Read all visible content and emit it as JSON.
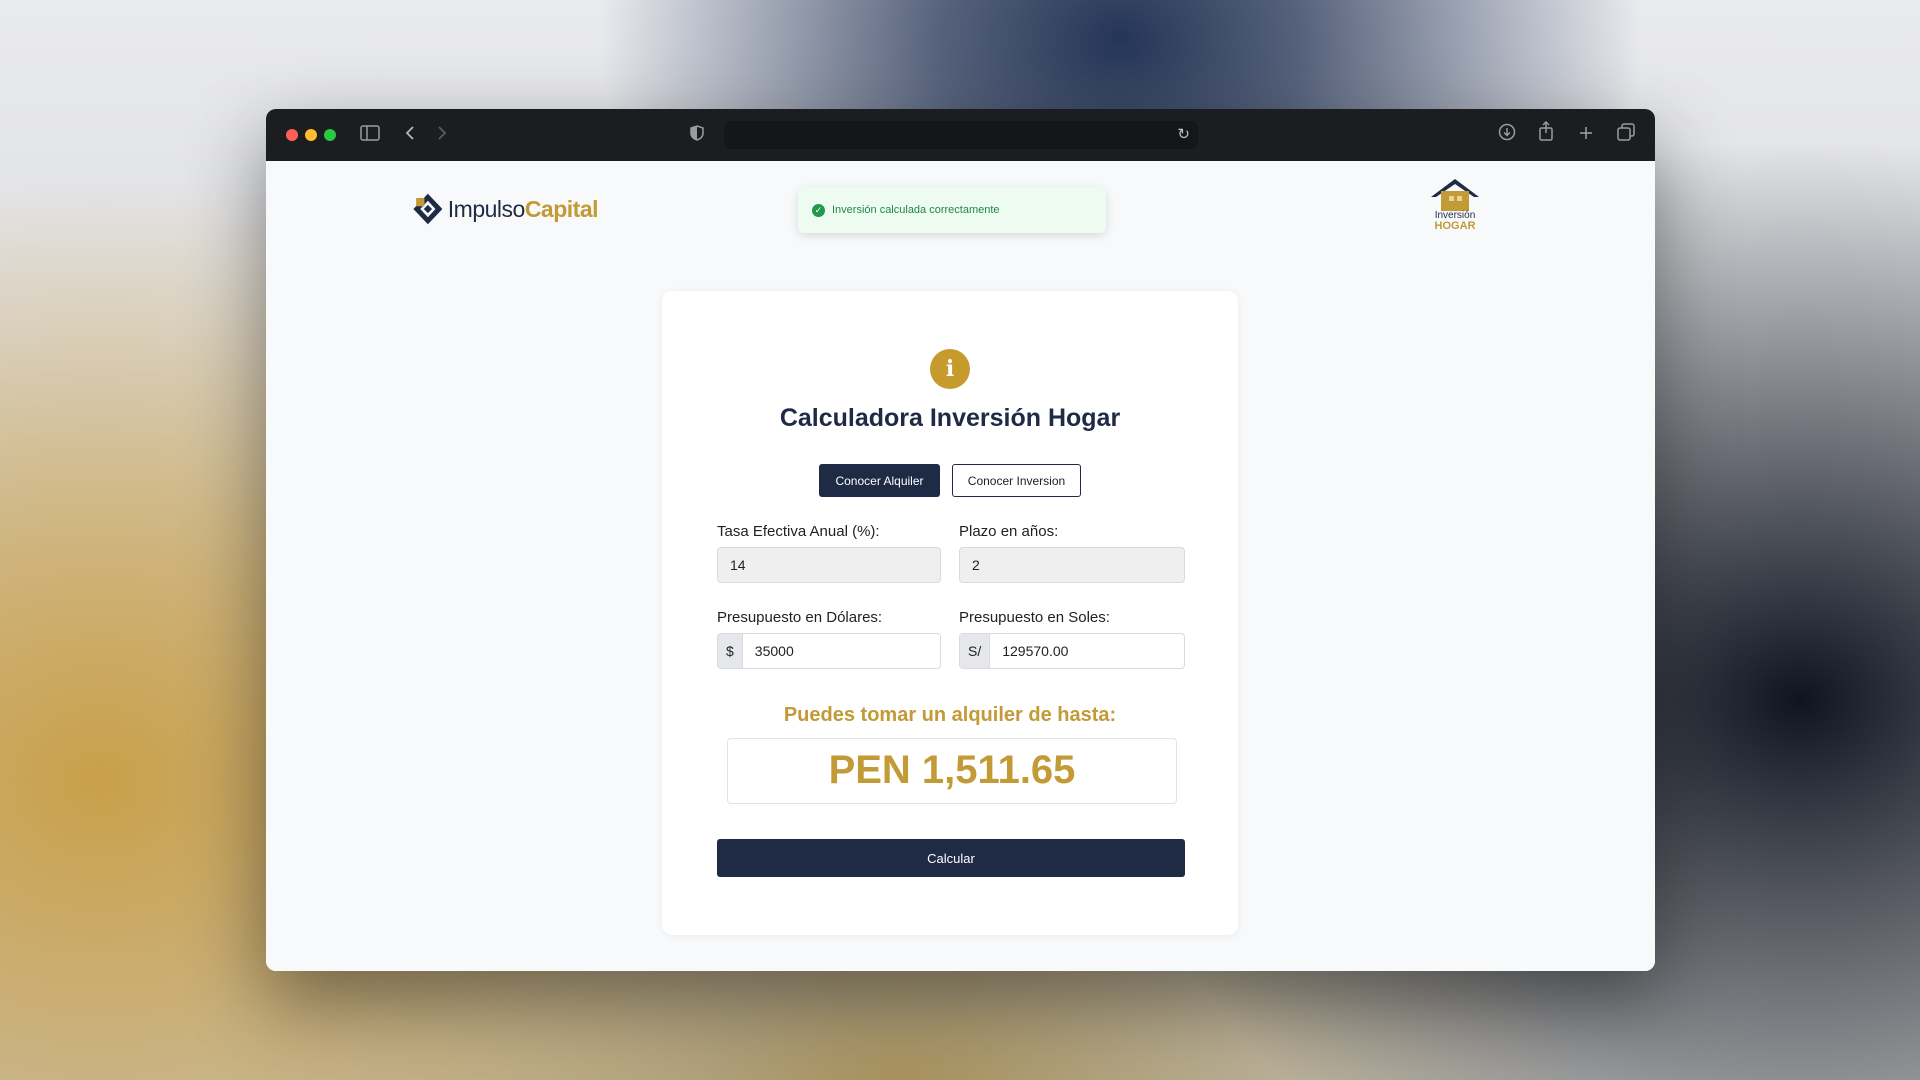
{
  "browser": {
    "sidebar_icon": "sidebar-icon",
    "back_icon": "chevron-left-icon",
    "forward_icon": "chevron-right-icon",
    "shield_icon": "shield-icon",
    "reload_icon": "reload-icon",
    "download_icon": "download-icon",
    "share_icon": "share-icon",
    "new_tab_icon": "plus-icon",
    "tabs_icon": "tabs-icon"
  },
  "header": {
    "logo_left": {
      "part1": "Impulso",
      "part2": "Capital"
    },
    "logo_right": {
      "line1": "Inversión",
      "line2": "HOGAR"
    },
    "toast": {
      "text": "Inversión calculada correctamente",
      "icon": "check-circle-icon"
    }
  },
  "calculator": {
    "title": "Calculadora Inversión Hogar",
    "icon": "info-icon",
    "tabs": {
      "alquiler": "Conocer Alquiler",
      "inversion": "Conocer Inversion"
    },
    "fields": {
      "tasa": {
        "label": "Tasa Efectiva Anual (%):",
        "value": "14"
      },
      "plazo": {
        "label": "Plazo en años:",
        "value": "2"
      },
      "dolares": {
        "label": "Presupuesto en Dólares:",
        "prefix": "$",
        "value": "35000"
      },
      "soles": {
        "label": "Presupuesto en Soles:",
        "prefix": "S/",
        "value": "129570.00"
      }
    },
    "result": {
      "label": "Puedes tomar un alquiler de hasta:",
      "value": "PEN 1,511.65"
    },
    "submit_label": "Calcular"
  },
  "colors": {
    "navy": "#1f2a44",
    "gold": "#c29a36",
    "success": "#1f9a49"
  }
}
